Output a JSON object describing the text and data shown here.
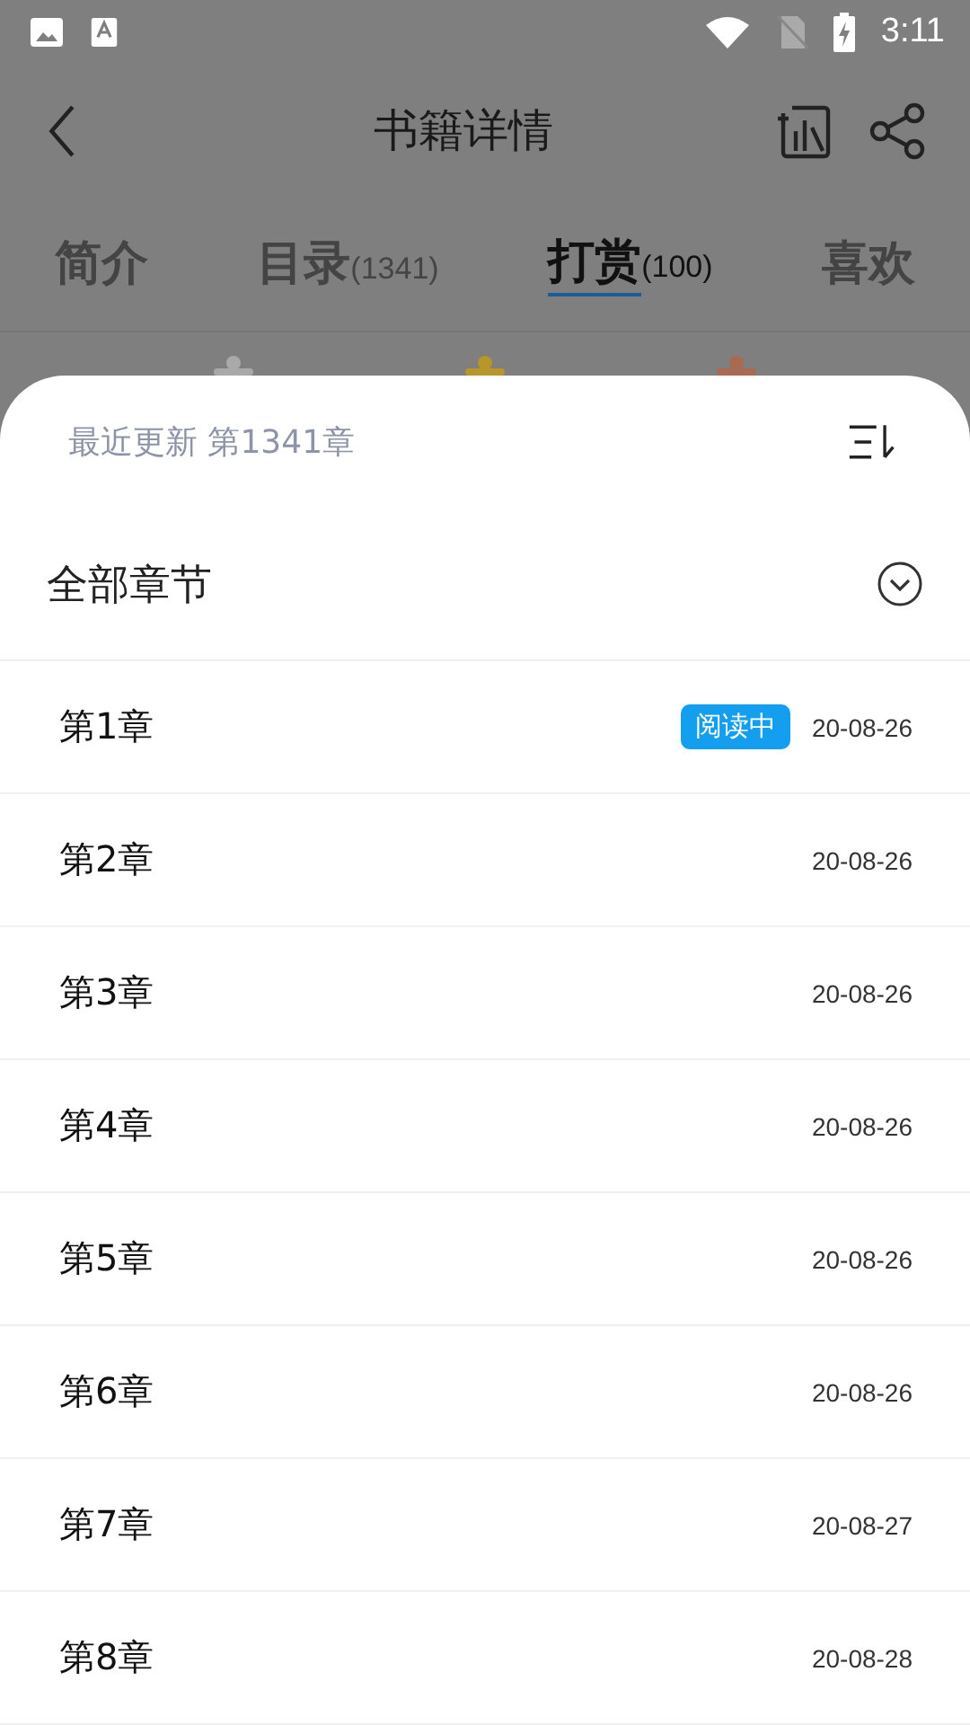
{
  "status_bar": {
    "time": "3:11"
  },
  "toolbar": {
    "title": "书籍详情"
  },
  "tabs": [
    {
      "label": "简介",
      "selected": false
    },
    {
      "label": "目录",
      "count": "(1341)",
      "selected": false
    },
    {
      "label": "打赏",
      "count": "(100)",
      "selected": true
    },
    {
      "label": "喜欢",
      "selected": false
    }
  ],
  "sheet": {
    "latest": "最近更新 第1341章",
    "section_title": "全部章节",
    "chapters": [
      {
        "title": "第1章",
        "badge": "阅读中",
        "date": "20-08-26"
      },
      {
        "title": "第2章",
        "date": "20-08-26"
      },
      {
        "title": "第3章",
        "date": "20-08-26"
      },
      {
        "title": "第4章",
        "date": "20-08-26"
      },
      {
        "title": "第5章",
        "date": "20-08-26"
      },
      {
        "title": "第6章",
        "date": "20-08-26"
      },
      {
        "title": "第7章",
        "date": "20-08-27"
      },
      {
        "title": "第8章",
        "date": "20-08-28"
      }
    ]
  }
}
